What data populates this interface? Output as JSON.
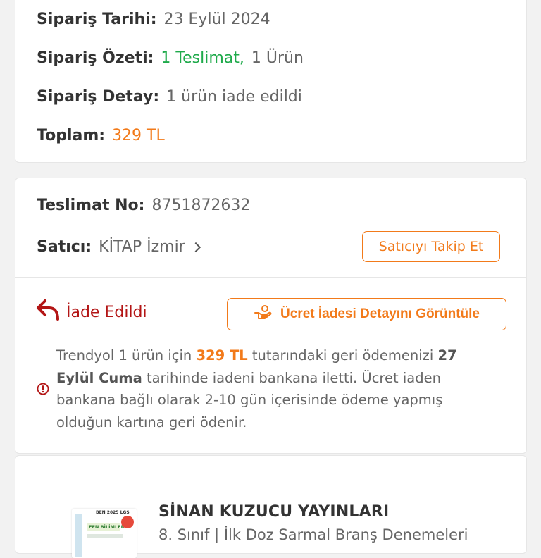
{
  "summary": {
    "order_date_label": "Sipariş Tarihi:",
    "order_date_value": "23 Eylül 2024",
    "order_summary_label": "Sipariş Özeti:",
    "order_summary_delivery": "1 Teslimat,",
    "order_summary_items": "1 Ürün",
    "order_detail_label": "Sipariş Detay:",
    "order_detail_value": "1 ürün iade edildi",
    "total_label": "Toplam:",
    "total_value": "329 TL"
  },
  "delivery": {
    "delivery_no_label": "Teslimat No:",
    "delivery_no_value": "8751872632",
    "seller_label": "Satıcı:",
    "seller_name": "KİTAP İzmir",
    "follow_seller_button": "Satıcıyı Takip Et",
    "status_text": "İade Edildi",
    "refund_detail_button": "Ücret İadesi Detayını Görüntüle",
    "refund_info": {
      "part1": "Trendyol 1 ürün için ",
      "amount": "329 TL",
      "part2": " tutarındaki geri ödemenizi ",
      "date": "27 Eylül Cuma",
      "part3": " tarihinde iadeni bankana iletti. Ücret iaden bankana bağlı olarak 2-10 gün içerisinde ödeme yapmış olduğun kartına geri ödenir."
    }
  },
  "product": {
    "brand": "SİNAN KUZUCU YAYINLARI",
    "name": "8. Sınıf | İlk Doz Sarmal Branş Denemeleri",
    "thumb_text_top": "BEN 2025 LGS",
    "thumb_text_title": "FEN BİLİMLERİ"
  },
  "colors": {
    "accent": "#f27a1a",
    "success": "#1faa4b",
    "returned": "#b31515"
  },
  "icons": {
    "return": "return-arrow-icon",
    "refund": "hand-money-icon",
    "info": "info-icon",
    "chevron": "chevron-right-icon"
  }
}
